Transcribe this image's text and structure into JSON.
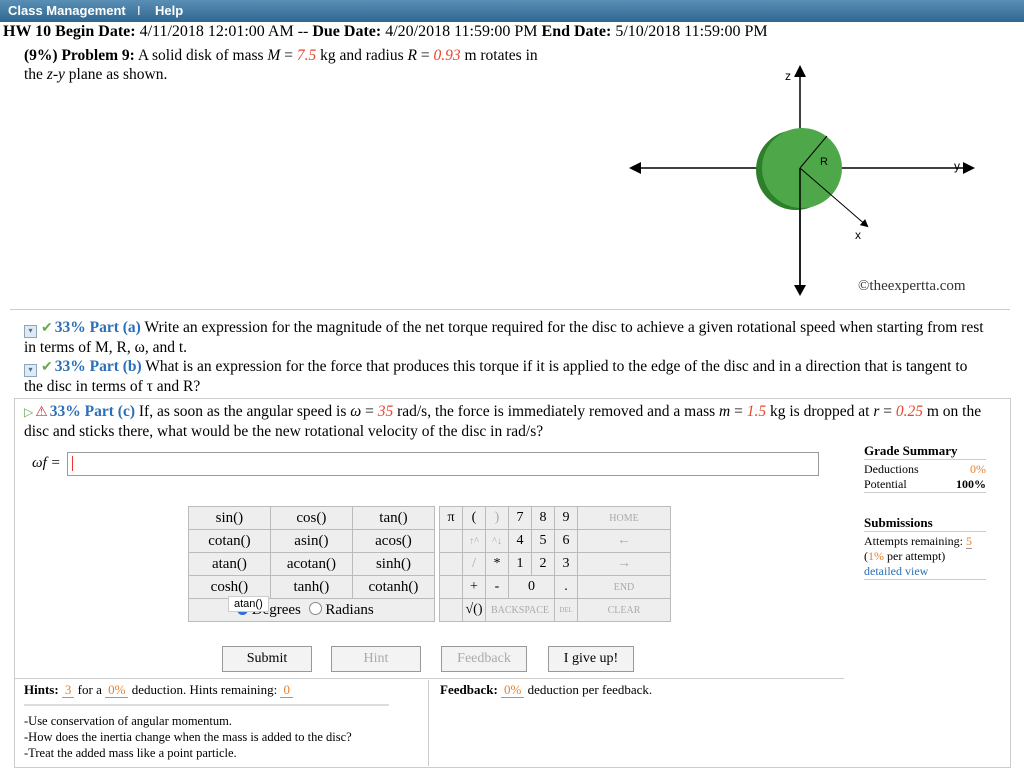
{
  "menu": {
    "item1": "Class Management",
    "sep": "I",
    "item2": "Help"
  },
  "hw": {
    "title": "HW 10",
    "begin_label": "Begin Date:",
    "begin": "4/11/2018 12:01:00 AM",
    "dash": "--",
    "due_label": "Due Date:",
    "due": "4/20/2018 11:59:00 PM",
    "end_label": "End Date:",
    "end": "5/10/2018 11:59:00 PM"
  },
  "problem": {
    "header": "(9%) Problem 9:",
    "t1": "A solid disk of mass",
    "M": "M",
    "eq": "=",
    "M_val": "7.5",
    "M_unit": "kg and radius",
    "R": "R",
    "R_val": "0.93",
    "R_unit": "m rotates in",
    "line2a": "the",
    "zy": "z-y",
    "line2b": "plane as shown."
  },
  "diagram": {
    "z": "z",
    "y": "y",
    "x": "x",
    "R": "R",
    "colors": {
      "disk": "#4ea84a",
      "disk_edge": "#2d7f2a"
    }
  },
  "watermark": "©theexpertta.com",
  "parts": {
    "a": {
      "pct": "33%",
      "name": "Part (a)",
      "text": "Write an expression for the magnitude of the net torque required for the disc to achieve a given rotational speed when starting from rest in terms of M, R, ω, and t."
    },
    "b": {
      "pct": "33%",
      "name": "Part (b)",
      "text": "What is an expression for the force that produces this torque if it is applied to the edge of the disc and in a direction that is tangent to the disc in terms of τ and R?"
    },
    "c": {
      "pct": "33%",
      "name": "Part (c)",
      "t1": "If, as soon as the angular speed is",
      "w": "ω",
      "eq": "=",
      "w_val": "35",
      "t2": "rad/s, the force is immediately removed and a mass",
      "m": "m",
      "m_val": "1.5",
      "t3": "kg is dropped at",
      "r": "r",
      "r_val": "0.25",
      "t4": "m on the disc and sticks there, what would be the new rotational velocity of the disc in rad/s?"
    }
  },
  "answer": {
    "label": "ωf =",
    "value": ""
  },
  "keypad": {
    "funcs": [
      [
        "sin()",
        "cos()",
        "tan()"
      ],
      [
        "cotan()",
        "asin()",
        "acos()"
      ],
      [
        "atan()",
        "acotan()",
        "sinh()"
      ],
      [
        "cosh()",
        "tanh()",
        "cotanh()"
      ]
    ],
    "degrees": "Degrees",
    "radians": "Radians",
    "pi": "π",
    "lparen": "(",
    "rparen": ")",
    "up1": "↑^",
    "up2": "^↓",
    "star": "*",
    "slash": "/",
    "plus": "+",
    "minus": "-",
    "sqrt": "√()",
    "digits": [
      "7",
      "8",
      "9",
      "4",
      "5",
      "6",
      "1",
      "2",
      "3",
      "0",
      "."
    ],
    "home": "HOME",
    "back_arrow": "←",
    "fwd_arrow": "→",
    "end": "END",
    "backspace": "BACKSPACE",
    "del": "DEL",
    "clear": "CLEAR"
  },
  "tooltip": "atan()",
  "buttons": {
    "submit": "Submit",
    "hint": "Hint",
    "feedback": "Feedback",
    "give_up": "I give up!"
  },
  "hints": {
    "label": "Hints:",
    "n": "3",
    "for_a": "for a",
    "pct": "0%",
    "rest": "deduction. Hints remaining:",
    "remaining": "0",
    "items": [
      "-Use conservation of angular momentum.",
      "-How does the inertia change when the mass is added to the disc?",
      "-Treat the added mass like a point particle."
    ]
  },
  "feedback": {
    "label": "Feedback:",
    "pct": "0%",
    "rest": "deduction per feedback."
  },
  "grade": {
    "title": "Grade Summary",
    "ded_label": "Deductions",
    "ded": "0%",
    "pot_label": "Potential",
    "pot": "100%",
    "sub_title": "Submissions",
    "attempts_label": "Attempts remaining:",
    "attempts": "5",
    "per_pct": "1%",
    "per_rest": "per attempt)",
    "per_open": "(",
    "detailed": "detailed view"
  }
}
